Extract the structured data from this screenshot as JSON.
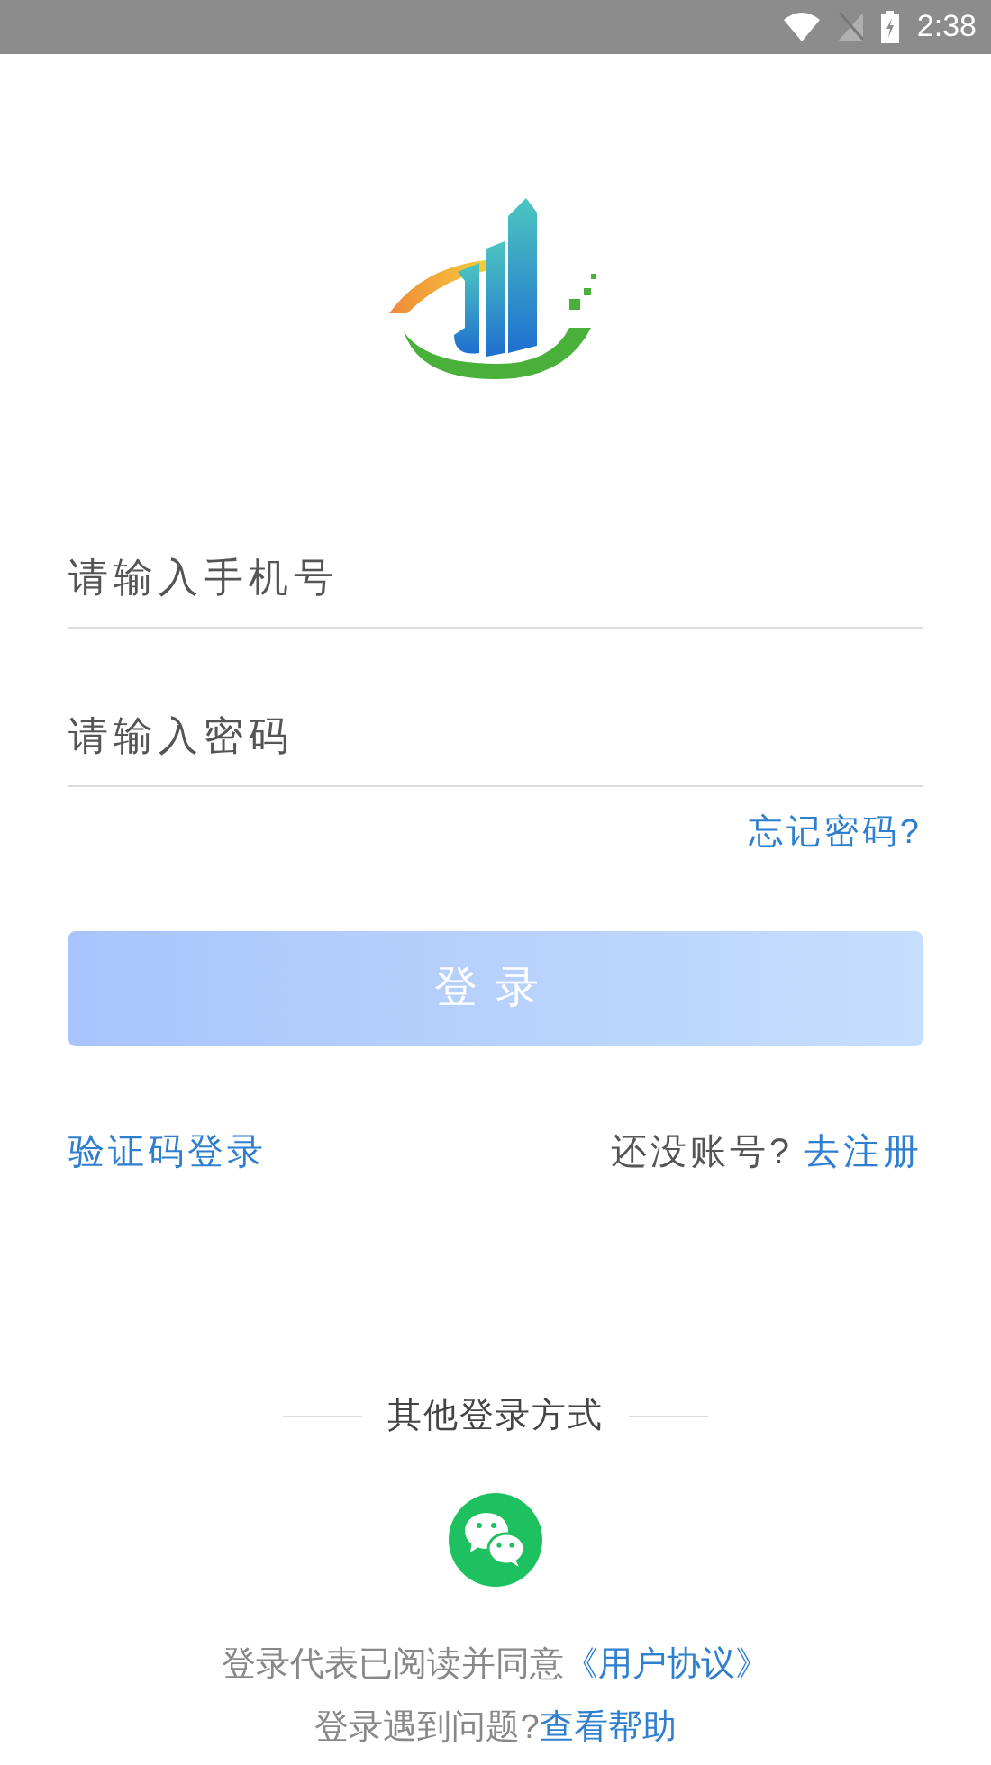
{
  "status_bar": {
    "time": "2:38"
  },
  "phone_field": {
    "placeholder": "请输入手机号"
  },
  "password_field": {
    "placeholder": "请输入密码"
  },
  "forgot_password": "忘记密码?",
  "login_button": {
    "label": "登录",
    "disabled": true
  },
  "sms_login": "验证码登录",
  "register": {
    "prompt": "还没账号?",
    "link": "去注册"
  },
  "other_login": {
    "title": "其他登录方式"
  },
  "agreement": {
    "text": "登录代表已阅读并同意",
    "link": "《用户协议》"
  },
  "help": {
    "text": "登录遇到问题?",
    "link": "查看帮助"
  }
}
